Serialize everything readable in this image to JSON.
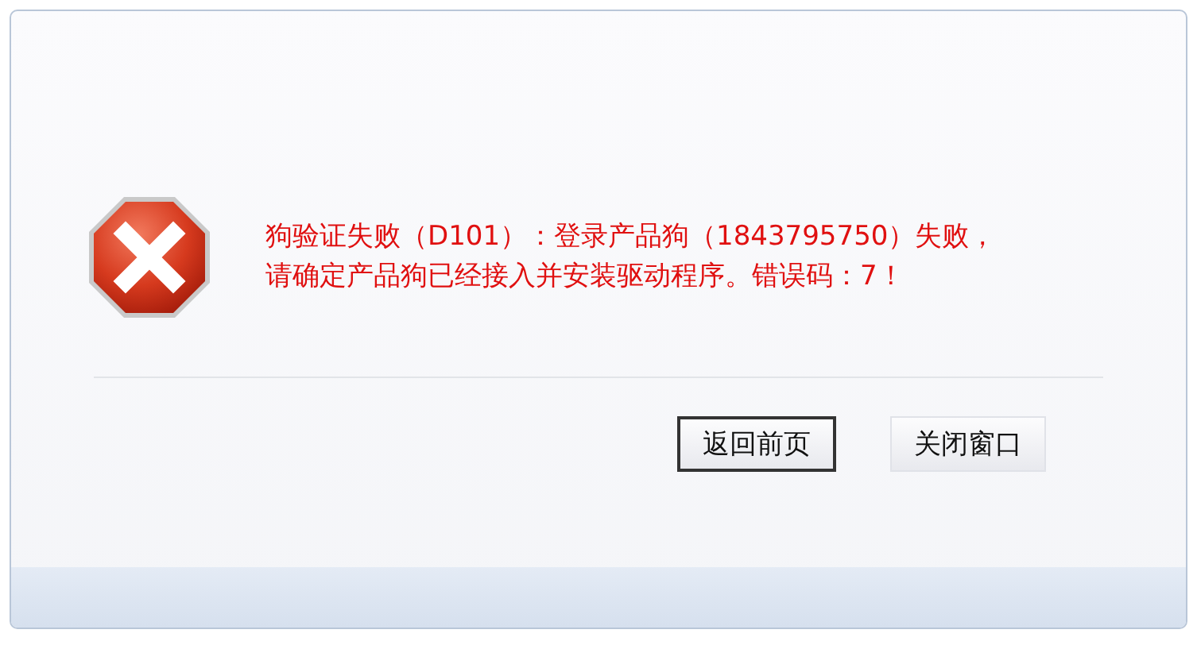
{
  "dialog": {
    "message": "狗验证失败（D101）：登录产品狗（1843795750）失败，请确定产品狗已经接入并安装驱动程序。错误码：7！"
  },
  "buttons": [
    {
      "label": "返回前页",
      "focused": true
    },
    {
      "label": "关闭窗口",
      "focused": false
    }
  ]
}
